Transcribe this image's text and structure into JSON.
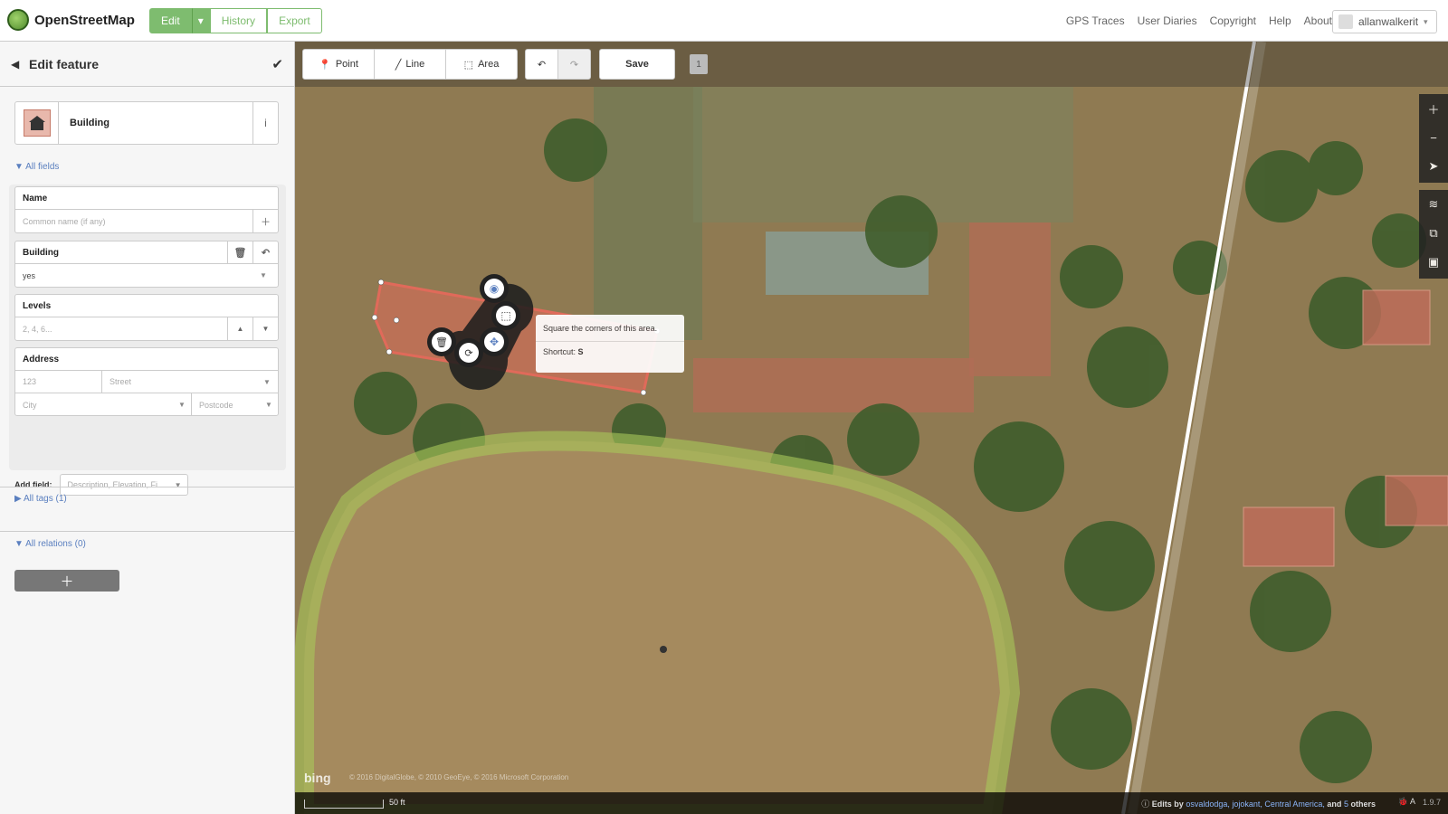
{
  "brand": {
    "name": "OpenStreetMap"
  },
  "header": {
    "edit_tab": "Edit",
    "history_tab": "History",
    "export_tab": "Export",
    "links": [
      "GPS Traces",
      "User Diaries",
      "Copyright",
      "Help",
      "About"
    ],
    "username": "allanwalkerit"
  },
  "sidebar": {
    "title": "Edit feature",
    "preset_name": "Building",
    "all_fields": "All fields",
    "fields": {
      "name_label": "Name",
      "name_placeholder": "Common name (if any)",
      "building_label": "Building",
      "building_value": "yes",
      "levels_label": "Levels",
      "levels_placeholder": "2, 4, 6...",
      "address_label": "Address",
      "housenumber_placeholder": "123",
      "street_placeholder": "Street",
      "city_placeholder": "City",
      "postcode_placeholder": "Postcode"
    },
    "add_field_label": "Add field:",
    "add_field_placeholder": "Description, Elevation, Fi...",
    "all_tags": "All tags (1)",
    "all_relations": "All relations (0)"
  },
  "toolbar": {
    "point": "Point",
    "line": "Line",
    "area": "Area",
    "save": "Save",
    "edit_count": "1"
  },
  "tooltip": {
    "text": "Square the corners of this area.",
    "shortcut_label": "Shortcut:",
    "shortcut_key": "S"
  },
  "footer": {
    "scale": "50 ft",
    "imagery": "bing",
    "imagery_attribution": "© 2016 DigitalGlobe, © 2010 GeoEye, © 2016 Microsoft Corporation",
    "edits_by": "Edits by",
    "editors": "osvaldodga, jojokant, Central America,",
    "and": "and",
    "others_count": "5",
    "others": "others",
    "version": "1.9.7"
  },
  "colors": {
    "osm_green": "#7ebc6f",
    "building_fill": "#e06a5a",
    "field_area": "#a8c85a"
  }
}
